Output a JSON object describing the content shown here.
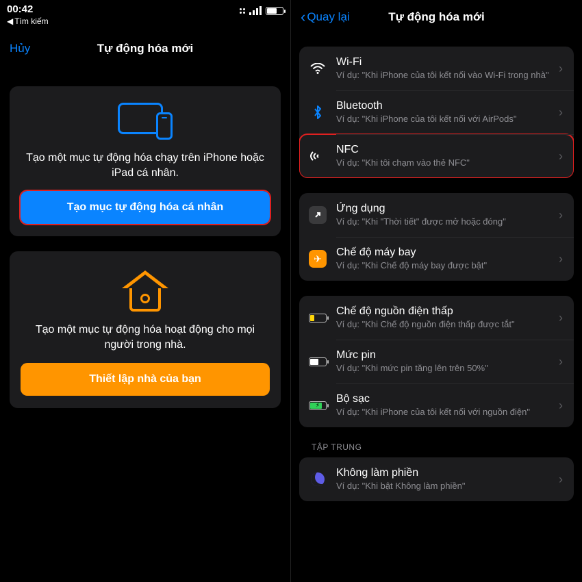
{
  "status": {
    "time": "00:42",
    "back": "Tìm kiếm"
  },
  "left": {
    "nav_cancel": "Hủy",
    "nav_title": "Tự động hóa mới",
    "card1_desc": "Tạo một mục tự động hóa chạy trên iPhone hoặc iPad cá nhân.",
    "card1_button": "Tạo mục tự động hóa cá nhân",
    "card2_desc": "Tạo một mục tự động hóa hoạt động cho mọi người trong nhà.",
    "card2_button": "Thiết lập nhà của bạn"
  },
  "right": {
    "nav_back": "Quay lại",
    "nav_title": "Tự động hóa mới",
    "groups": [
      [
        {
          "name": "Wi-Fi",
          "sub": "Ví dụ: \"Khi iPhone của tôi kết nối vào Wi-Fi trong nhà\""
        },
        {
          "name": "Bluetooth",
          "sub": "Ví dụ: \"Khi iPhone của tôi kết nối với AirPods\""
        },
        {
          "name": "NFC",
          "sub": "Ví dụ: \"Khi tôi chạm vào thẻ NFC\""
        }
      ],
      [
        {
          "name": "Ứng dụng",
          "sub": "Ví dụ: \"Khi \"Thời tiết\" được mở hoặc đóng\""
        },
        {
          "name": "Chế độ máy bay",
          "sub": "Ví dụ: \"Khi Chế độ máy bay được bật\""
        }
      ],
      [
        {
          "name": "Chế độ nguồn điện thấp",
          "sub": "Ví dụ: \"Khi Chế độ nguồn điện thấp được tắt\""
        },
        {
          "name": "Mức pin",
          "sub": "Ví dụ: \"Khi mức pin tăng lên trên 50%\""
        },
        {
          "name": "Bộ sạc",
          "sub": "Ví dụ: \"Khi iPhone của tôi kết nối với nguồn điện\""
        }
      ]
    ],
    "group3_header": "TẬP TRUNG",
    "group3_row": {
      "name": "Không làm phiền",
      "sub": "Ví dụ: \"Khi bật Không làm phiền\""
    }
  }
}
